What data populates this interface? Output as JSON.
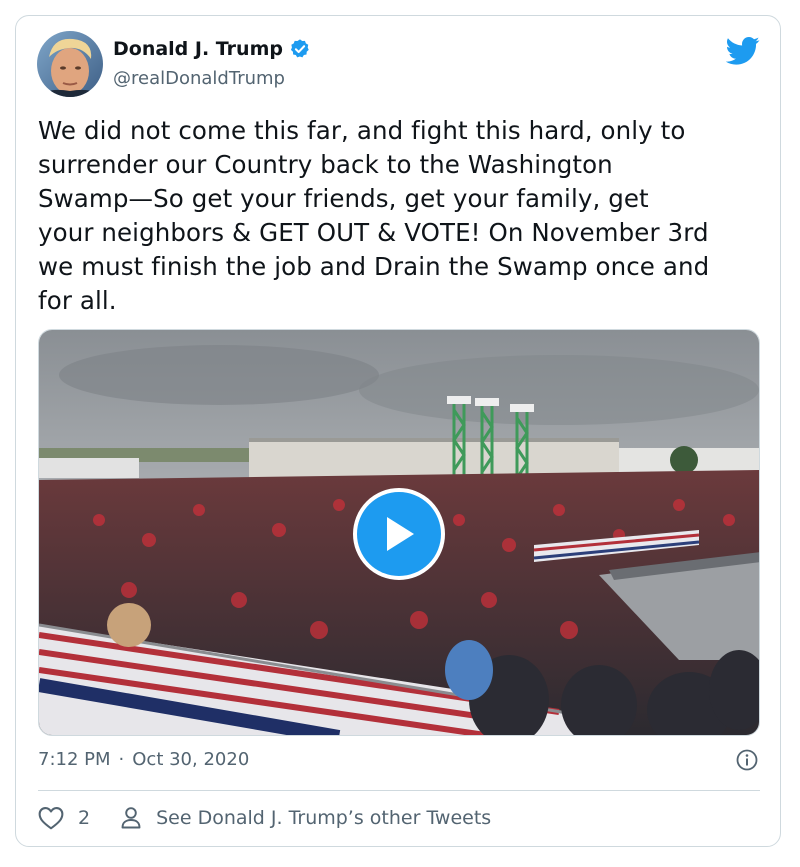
{
  "author": {
    "name": "Donald J. Trump",
    "handle": "@realDonaldTrump",
    "verified": true
  },
  "tweet": {
    "text": "We did not come this far, and fight this hard, only to\nsurrender our Country back to the Washington\nSwamp—So get your friends, get your family, get\nyour neighbors & GET OUT & VOTE! On November 3rd\nwe must finish the job and Drain the Swamp once and\nfor all.",
    "time": "7:12 PM",
    "separator": "·",
    "date": "Oct 30, 2020"
  },
  "media": {
    "type": "video",
    "description_icon": "play-icon"
  },
  "actions": {
    "like_count": "2",
    "other_tweets_label": "See Donald J. Trump’s other Tweets"
  },
  "colors": {
    "accent": "#1d9bf0",
    "text_primary": "#0f1419",
    "text_secondary": "#536471",
    "border": "#cfd9de"
  }
}
